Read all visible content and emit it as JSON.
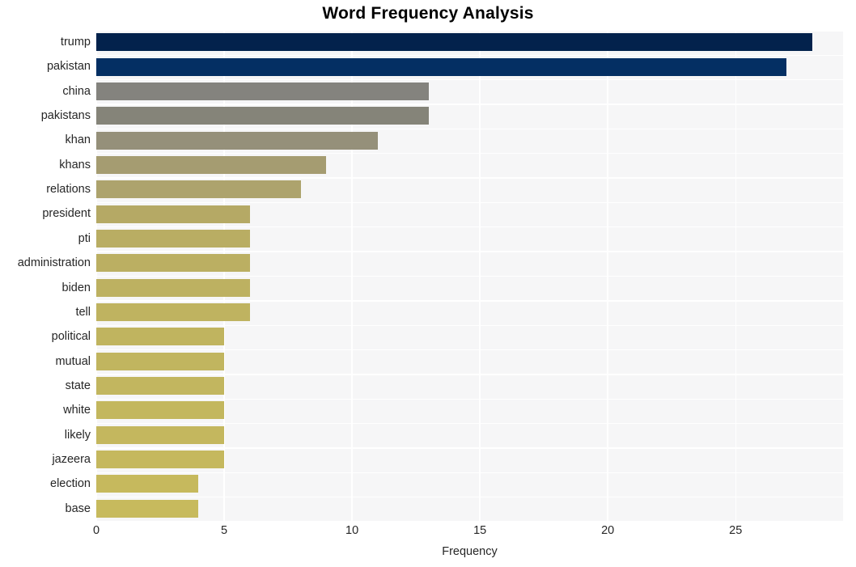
{
  "chart_data": {
    "type": "bar",
    "orientation": "horizontal",
    "title": "Word Frequency Analysis",
    "xlabel": "Frequency",
    "ylabel": "",
    "xlim": [
      0,
      29.2
    ],
    "ylim": [
      0,
      20
    ],
    "grid": true,
    "legend": false,
    "xticks": [
      0,
      5,
      10,
      15,
      20,
      25
    ],
    "xtick_labels": [
      "0",
      "5",
      "10",
      "15",
      "20",
      "25"
    ],
    "categories": [
      "trump",
      "pakistan",
      "china",
      "pakistans",
      "khan",
      "khans",
      "relations",
      "president",
      "pti",
      "administration",
      "biden",
      "tell",
      "political",
      "mutual",
      "state",
      "white",
      "likely",
      "jazeera",
      "election",
      "base"
    ],
    "values": [
      28,
      27,
      13,
      13,
      11,
      9,
      8,
      6,
      6,
      6,
      6,
      6,
      5,
      5,
      5,
      5,
      5,
      5,
      4,
      4
    ],
    "bar_colors": [
      "#03224c",
      "#042f63",
      "#84837e",
      "#858479",
      "#95907a",
      "#a59c71",
      "#ada36d",
      "#b5a965",
      "#b9ad63",
      "#bbaf62",
      "#bdb161",
      "#bfb360",
      "#c0b45f",
      "#c1b55f",
      "#c2b65f",
      "#c3b75e",
      "#c4b75e",
      "#c5b85e",
      "#c6b95d",
      "#c7ba5d"
    ],
    "plot_background": "#f6f6f7",
    "gridline_color": "#ffffff",
    "figure_background": "#ffffff",
    "text_color": "#262626"
  }
}
